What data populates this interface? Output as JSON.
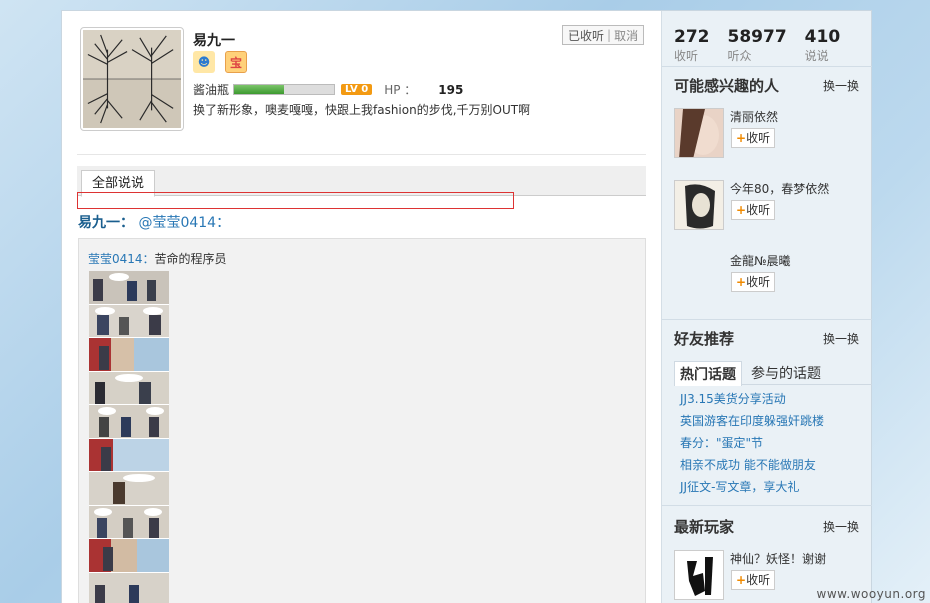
{
  "profile": {
    "name": "易九一",
    "level_name": "酱油瓶",
    "level_badge": "LV 0",
    "hp_label": "HP ：",
    "hp_value": "195",
    "hp_fill_fraction": 0.5,
    "bio": "换了新形象，噢麦嘎嘎，快跟上我fashion的步伐,千万别OUT啊",
    "follow_state": "已收听",
    "cancel_label": "取消",
    "medals": [
      "user-medal-icon",
      "treasure-medal-icon"
    ]
  },
  "tabs": {
    "all_posts": "全部说说"
  },
  "post": {
    "author": "易九一：",
    "mention": "@莹莹0414：",
    "repost_author": "莹莹0414：",
    "repost_text": "苦命的程序员"
  },
  "sidebar": {
    "stats": [
      {
        "value": "272",
        "label": "收听"
      },
      {
        "value": "58977",
        "label": "听众"
      },
      {
        "value": "410",
        "label": "说说"
      }
    ],
    "interested_title": "可能感兴趣的人",
    "swap_label": "换一换",
    "follow_label": "收听",
    "interested": [
      {
        "name": "清丽依然"
      },
      {
        "name": "今年80，春梦依然"
      },
      {
        "name": "金龍№晨曦"
      }
    ],
    "friends_title": "好友推荐",
    "topic_tabs": {
      "hot": "热门话题",
      "joined": "参与的话题"
    },
    "topics": [
      "JJ3.15美货分享活动",
      "英国游客在印度躲强奸跳楼",
      "春分：\"蛋定\"节",
      "相亲不成功 能不能做朋友",
      "JJ征文-写文章，享大礼"
    ],
    "newest_title": "最新玩家",
    "newest": [
      {
        "name": "神仙？妖怪！谢谢"
      }
    ]
  },
  "watermark": "www.wooyun.org",
  "colors": {
    "link": "#2877b5",
    "accent": "#f08a00",
    "hp_fill": "#3c9a2f",
    "highlight_box": "#d33333"
  }
}
